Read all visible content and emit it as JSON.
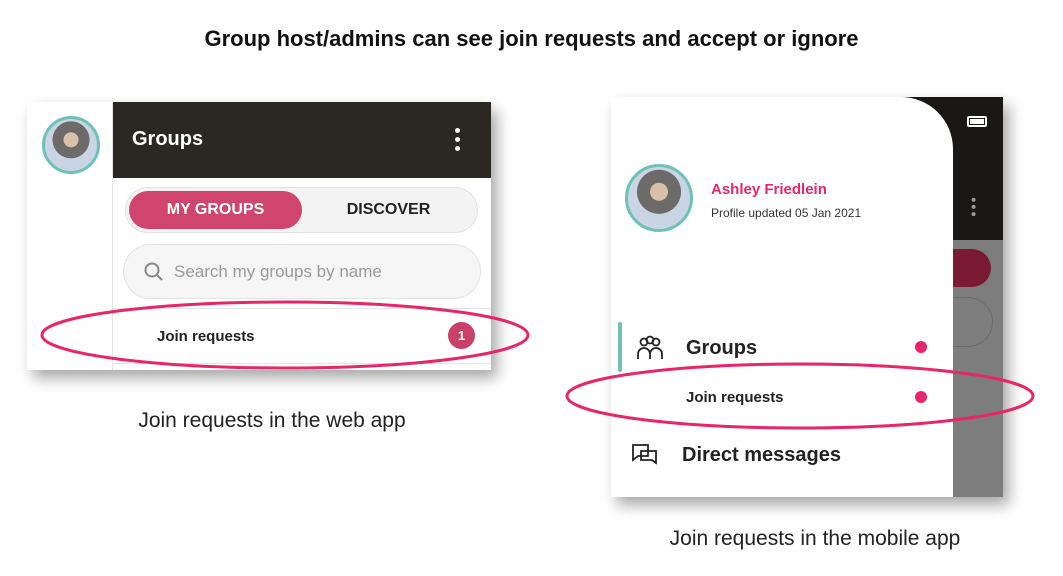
{
  "title": "Group host/admins can see join requests and accept or ignore",
  "web": {
    "caption": "Join requests in the web app",
    "header_title": "Groups",
    "tabs": [
      {
        "label": "MY GROUPS",
        "active": true
      },
      {
        "label": "DISCOVER",
        "active": false
      }
    ],
    "search_placeholder": "Search my groups by name",
    "join_requests_label": "Join requests",
    "join_requests_count": "1"
  },
  "mobile": {
    "caption": "Join requests in the mobile app",
    "profile_name": "Ashley Friedlein",
    "profile_subtitle": "Profile updated 05 Jan 2021",
    "nav": {
      "groups": "Groups",
      "join_requests": "Join requests",
      "direct_messages": "Direct messages"
    }
  },
  "colors": {
    "accent": "#d0456e",
    "highlight": "#e8256b",
    "teal": "#6cc3b5",
    "header": "#2b2823"
  }
}
